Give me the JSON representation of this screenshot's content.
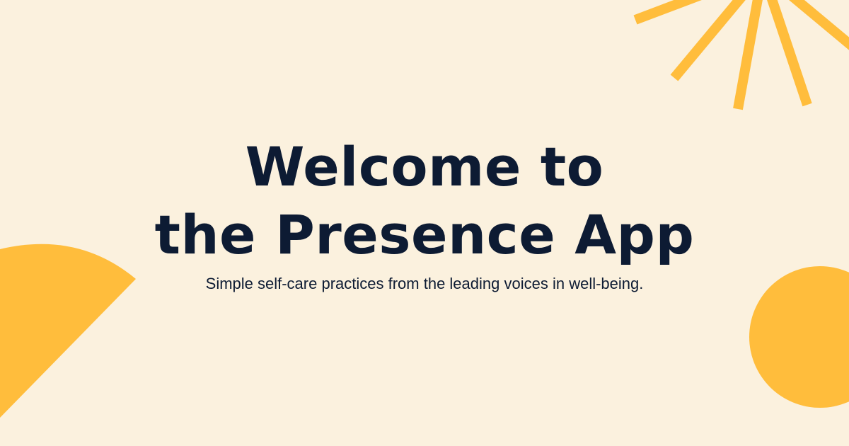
{
  "headline": {
    "line1": "Welcome to",
    "line2": "the Presence App"
  },
  "tagline": "Simple self-care practices from the leading voices in well-being.",
  "colors": {
    "background": "#FBF1DE",
    "accent": "#FFBD3C",
    "text": "#0D1B33"
  }
}
